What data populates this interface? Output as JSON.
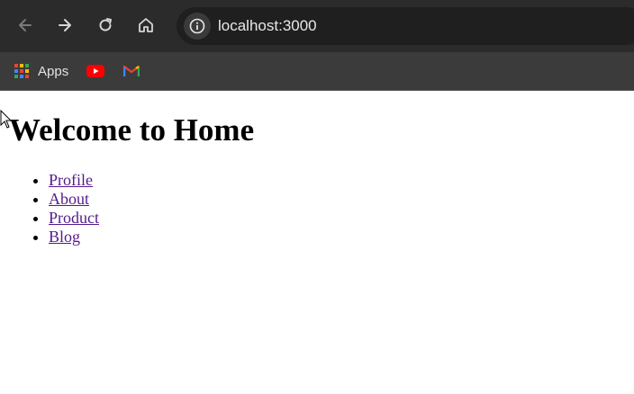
{
  "browser": {
    "url": "localhost:3000",
    "bookmarks": [
      {
        "label": "Apps",
        "icon": "apps-grid-icon"
      },
      {
        "label": "",
        "icon": "youtube-icon"
      },
      {
        "label": "",
        "icon": "gmail-icon"
      }
    ],
    "colors": {
      "toolbar": "#2b2b2b",
      "bookmarks_bar": "#3b3b3b",
      "omnibox": "#1f1f1f",
      "link": "#551a8b"
    }
  },
  "page": {
    "heading": "Welcome to Home",
    "links": [
      {
        "label": "Profile"
      },
      {
        "label": "About"
      },
      {
        "label": "Product"
      },
      {
        "label": "Blog"
      }
    ]
  }
}
